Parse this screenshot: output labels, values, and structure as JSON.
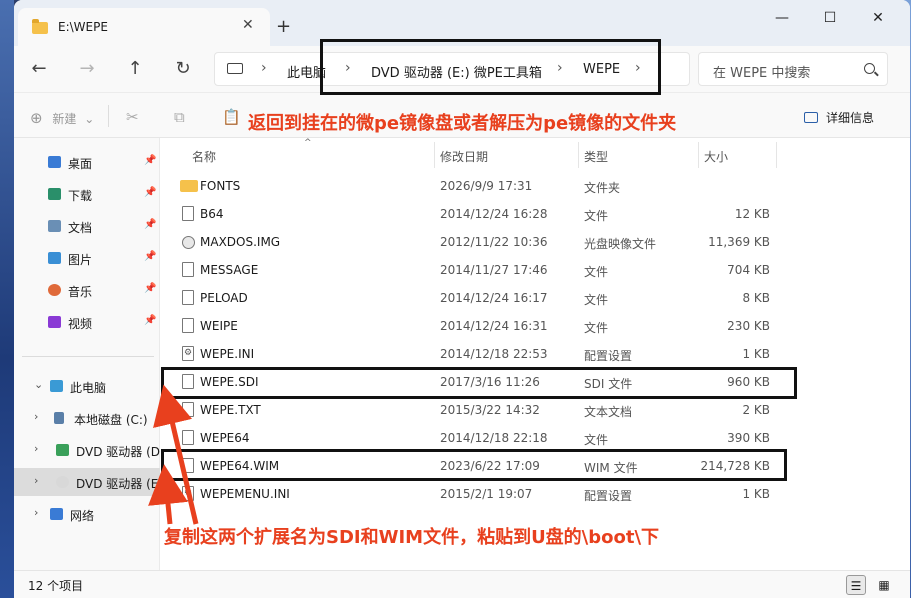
{
  "window": {
    "tab_title": "E:\\WEPE",
    "tab_close": "✕",
    "new_tab": "+",
    "minimize": "—",
    "maximize": "☐",
    "close": "✕"
  },
  "nav": {
    "back": "←",
    "forward": "→",
    "up": "↑",
    "refresh": "↻"
  },
  "address": {
    "crumbs": [
      "此电脑",
      "DVD 驱动器 (E:) 微PE工具箱",
      "WEPE"
    ],
    "separator": "›",
    "search_placeholder": "在 WEPE 中搜索"
  },
  "toolbar": {
    "new_label": "新建",
    "new_chevron": "⌄",
    "cut": "✂",
    "copy": "⧉",
    "paste": "📋",
    "details_label": "详细信息"
  },
  "sidebar": {
    "pinned": [
      {
        "label": "桌面",
        "icon": "desktop-icon",
        "color": "#3a7bd5"
      },
      {
        "label": "下载",
        "icon": "download-icon",
        "color": "#2a8f6a"
      },
      {
        "label": "文档",
        "icon": "documents-icon",
        "color": "#6a8fb5"
      },
      {
        "label": "图片",
        "icon": "pictures-icon",
        "color": "#3a8fd5"
      },
      {
        "label": "音乐",
        "icon": "music-icon",
        "color": "#e06a3a"
      },
      {
        "label": "视频",
        "icon": "videos-icon",
        "color": "#8a3ad5"
      }
    ],
    "pin_glyph": "📌",
    "this_pc": "此电脑",
    "tree": [
      {
        "label": "本地磁盘 (C:)",
        "icon": "local-disk-icon"
      },
      {
        "label": "DVD 驱动器 (D",
        "icon": "dvd-drive-icon"
      },
      {
        "label": "DVD 驱动器 (E",
        "icon": "dvd-drive-icon"
      },
      {
        "label": "网络",
        "icon": "network-icon"
      }
    ],
    "expand_glyph": "›",
    "expanded_glyph": "⌄"
  },
  "columns": {
    "name": "名称",
    "date": "修改日期",
    "type": "类型",
    "size": "大小",
    "sort_glyph": "^"
  },
  "files": [
    {
      "name": "FONTS",
      "date": "2026/9/9 17:31",
      "type": "文件夹",
      "size": "",
      "icon": "folder-icon"
    },
    {
      "name": "B64",
      "date": "2014/12/24 16:28",
      "type": "文件",
      "size": "12 KB",
      "icon": "file-icon"
    },
    {
      "name": "MAXDOS.IMG",
      "date": "2012/11/22 10:36",
      "type": "光盘映像文件",
      "size": "11,369 KB",
      "icon": "disc-image-icon"
    },
    {
      "name": "MESSAGE",
      "date": "2014/11/27 17:46",
      "type": "文件",
      "size": "704 KB",
      "icon": "file-icon"
    },
    {
      "name": "PELOAD",
      "date": "2014/12/24 16:17",
      "type": "文件",
      "size": "8 KB",
      "icon": "file-icon"
    },
    {
      "name": "WEIPE",
      "date": "2014/12/24 16:31",
      "type": "文件",
      "size": "230 KB",
      "icon": "file-icon"
    },
    {
      "name": "WEPE.INI",
      "date": "2014/12/18 22:53",
      "type": "配置设置",
      "size": "1 KB",
      "icon": "config-file-icon"
    },
    {
      "name": "WEPE.SDI",
      "date": "2017/3/16 11:26",
      "type": "SDI 文件",
      "size": "960 KB",
      "icon": "file-icon"
    },
    {
      "name": "WEPE.TXT",
      "date": "2015/3/22 14:32",
      "type": "文本文档",
      "size": "2 KB",
      "icon": "text-file-icon"
    },
    {
      "name": "WEPE64",
      "date": "2014/12/18 22:18",
      "type": "文件",
      "size": "390 KB",
      "icon": "file-icon"
    },
    {
      "name": "WEPE64.WIM",
      "date": "2023/6/22 17:09",
      "type": "WIM 文件",
      "size": "214,728 KB",
      "icon": "file-icon"
    },
    {
      "name": "WEPEMENU.INI",
      "date": "2015/2/1 19:07",
      "type": "配置设置",
      "size": "1 KB",
      "icon": "config-file-icon"
    }
  ],
  "status": {
    "count": "12 个项目",
    "details_view": "☰",
    "tiles_view": "▦"
  },
  "annotations": {
    "top_note": "返回到挂在的微pe镜像盘或者解压为pe镜像的文件夹",
    "bottom_note": "复制这两个扩展名为SDI和WIM文件，粘贴到U盘的\\boot\\下",
    "color": "#e8401e"
  }
}
